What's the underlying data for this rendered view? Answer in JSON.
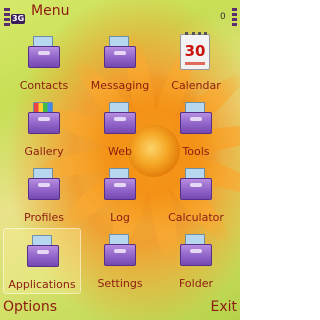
{
  "status": {
    "title": "Menu",
    "network": "3G",
    "battery_label": "0",
    "signal_level": 1.0,
    "battery_level": 1.0
  },
  "menu_items": [
    {
      "label": "Contacts",
      "icon": "contacts-icon"
    },
    {
      "label": "Messaging",
      "icon": "messaging-icon"
    },
    {
      "label": "Calendar",
      "icon": "calendar-icon",
      "calendar_day": "30"
    },
    {
      "label": "Gallery",
      "icon": "gallery-icon"
    },
    {
      "label": "Web",
      "icon": "web-icon"
    },
    {
      "label": "Tools",
      "icon": "tools-icon"
    },
    {
      "label": "Profiles",
      "icon": "profiles-icon"
    },
    {
      "label": "Log",
      "icon": "log-icon"
    },
    {
      "label": "Calculator",
      "icon": "calculator-icon"
    },
    {
      "label": "Applications",
      "icon": "applications-icon",
      "selected": true
    },
    {
      "label": "Settings",
      "icon": "settings-icon"
    },
    {
      "label": "Folder",
      "icon": "folder-icon"
    }
  ],
  "softkeys": {
    "left": "Options",
    "right": "Exit"
  },
  "colors": {
    "label_text": "#8c1c10",
    "folder_purple": "#8f63c8",
    "flower_orange": "#f08a12",
    "background_green": "#c7de55"
  }
}
